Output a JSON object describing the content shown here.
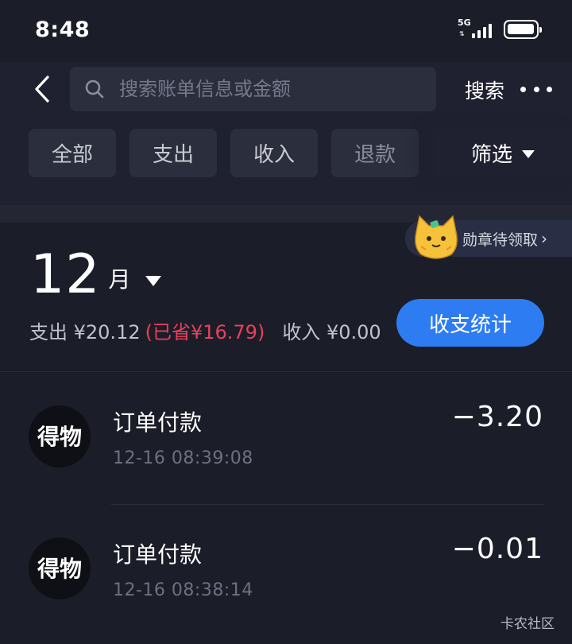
{
  "status_bar": {
    "time": "8:48",
    "network": "5G",
    "signal_bars": 4,
    "battery_level": 0.9
  },
  "header": {
    "back_icon": "chevron-left-icon",
    "search_icon": "search-icon",
    "search_placeholder": "搜索账单信息或金额",
    "search_label": "搜索",
    "more_icon": "more-horizontal-icon"
  },
  "filters": {
    "chips": [
      {
        "label": "全部"
      },
      {
        "label": "支出"
      },
      {
        "label": "收入"
      },
      {
        "label": "退款"
      }
    ],
    "screen_label": "筛选"
  },
  "badge_banner": {
    "label": "勋章待领取",
    "icon": "cat-mascot-icon"
  },
  "summary": {
    "month": "12",
    "month_unit": "月",
    "expense": "支出 ¥20.12",
    "saved": "(已省¥16.79)",
    "income": "收入 ¥0.00",
    "stats_button": "收支统计"
  },
  "transactions": [
    {
      "logo": "得物",
      "title": "订单付款",
      "time": "12-16 08:39:08",
      "amount": "−3.20"
    },
    {
      "logo": "得物",
      "title": "订单付款",
      "time": "12-16 08:38:14",
      "amount": "−0.01"
    }
  ],
  "watermark": "卡农社区",
  "colors": {
    "background": "#1b1d29",
    "panel": "#1f2130",
    "chip": "#2b2e3d",
    "accent_blue": "#2d7cf2",
    "saved_red": "#e8415a"
  }
}
